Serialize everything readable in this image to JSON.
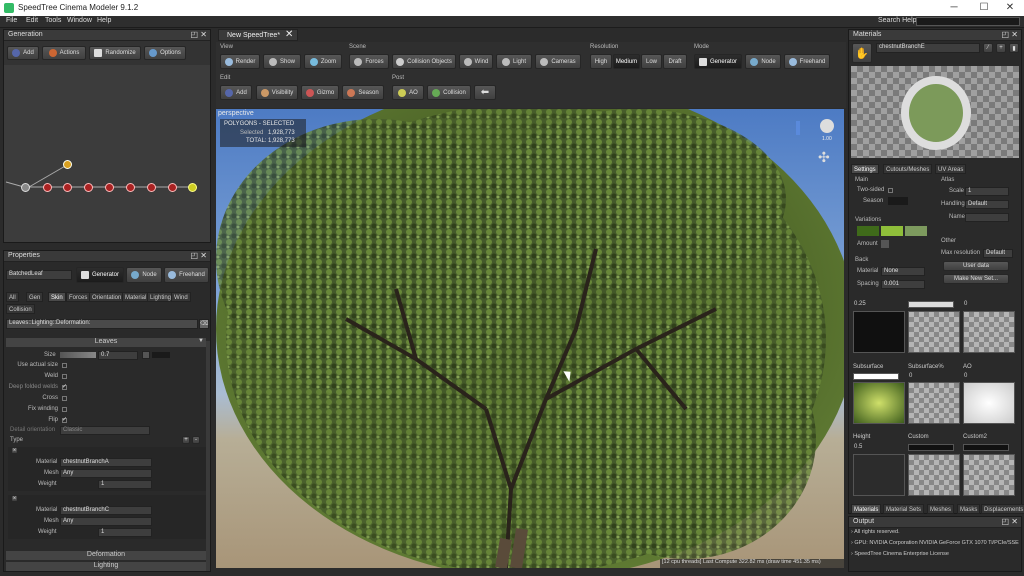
{
  "app": {
    "title": "SpeedTree Cinema Modeler 9.1.2"
  },
  "menu": [
    "File",
    "Edit",
    "Tools",
    "Window",
    "Help"
  ],
  "search_help": "Search Help:",
  "generation": {
    "title": "Generation",
    "buttons": [
      "Add",
      "Actions",
      "Randomize",
      "Options"
    ]
  },
  "properties": {
    "title": "Properties",
    "object_name": "BatchedLeaf",
    "mode_buttons": [
      "Generator",
      "Node",
      "Freehand"
    ],
    "tabs": [
      "All",
      "Gen",
      "Skin",
      "Forces",
      "Orientation",
      "Material",
      "Lighting",
      "Wind",
      "Collision"
    ],
    "filter": "Leaves::Lighting::Deformation:",
    "section_leaves": "Leaves",
    "size_label": "Size",
    "size_value": "0.7",
    "rows": [
      {
        "label": "Use actual size",
        "checked": false
      },
      {
        "label": "Weld",
        "checked": false
      },
      {
        "label": "Deep folded welds",
        "checked": true
      },
      {
        "label": "Cross",
        "checked": false
      },
      {
        "label": "Fix winding",
        "checked": false
      },
      {
        "label": "Flip",
        "checked": true
      }
    ],
    "detail_orientation": "Detail orientation",
    "detail_value": "Classic",
    "type_label": "Type",
    "group1": {
      "material_label": "Material",
      "material": "chestnutBranchA",
      "mesh_label": "Mesh",
      "mesh": "Any",
      "weight_label": "Weight",
      "weight": "1"
    },
    "group2": {
      "material_label": "Material",
      "material": "chestnutBranchC",
      "mesh_label": "Mesh",
      "mesh": "Any",
      "weight_label": "Weight",
      "weight": "1"
    },
    "section_deformation": "Deformation",
    "section_lighting": "Lighting"
  },
  "doc_tab": "New SpeedTree*",
  "toolbar": {
    "view_label": "View",
    "view": [
      "Render",
      "Show",
      "Zoom"
    ],
    "scene_label": "Scene",
    "scene": [
      "Forces",
      "Collision Objects",
      "Wind",
      "Light",
      "Cameras"
    ],
    "resolution_label": "Resolution",
    "resolution": [
      "High",
      "Medium",
      "Low",
      "Draft"
    ],
    "mode_label": "Mode",
    "mode": [
      "Generator",
      "Node",
      "Freehand"
    ],
    "edit_label": "Edit",
    "edit": [
      "Add",
      "Visibility",
      "Gizmo",
      "Season"
    ],
    "post_label": "Post",
    "post": [
      "AO",
      "Collision"
    ]
  },
  "viewport": {
    "label": "perspective",
    "polygons": "POLYGONS - SELECTED",
    "sel_label": "Selected",
    "selected": "1,928,773",
    "total_label": "TOTAL:",
    "total": "1,928,773",
    "status": "[12 cpu threads] Last Compute 322.82 ms (draw time 451.35 ms)",
    "light_value": "1.00"
  },
  "materials": {
    "title": "Materials",
    "name": "chestnutBranchE",
    "tabs": [
      "Settings",
      "Cutouts/Meshes",
      "UV Areas"
    ],
    "main_label": "Main",
    "two_sided": "Two-sided",
    "season": "Season",
    "atlas_label": "Atlas",
    "scale_label": "Scale",
    "scale": "1",
    "handling_label": "Handling",
    "handling": "Default",
    "name_label": "Name",
    "variations_label": "Variations",
    "amount_label": "Amount",
    "back_label": "Back",
    "material_label": "Material",
    "back_material": "None",
    "spacing_label": "Spacing",
    "spacing": "0.001",
    "other_label": "Other",
    "max_res_label": "Max resolution",
    "max_res": "Default",
    "user_data": "User data",
    "make_new_set": "Make New Set...",
    "variation_colors": [
      "#3f6a1a",
      "#8fbe3a",
      "#7d9a5e"
    ],
    "slots": [
      {
        "name": "",
        "value": "0.25"
      },
      {
        "name": "",
        "value": ""
      },
      {
        "name": "",
        "value": "0"
      },
      {
        "name": "Subsurface",
        "value": ""
      },
      {
        "name": "Subsurface%",
        "value": "0"
      },
      {
        "name": "AO",
        "value": "0"
      },
      {
        "name": "Height",
        "value": "0.5"
      },
      {
        "name": "Custom",
        "value": ""
      },
      {
        "name": "Custom2",
        "value": ""
      }
    ],
    "bottom_tabs": [
      "Materials",
      "Material Sets",
      "Meshes",
      "Masks",
      "Displacements"
    ]
  },
  "output": {
    "title": "Output",
    "lines": [
      "All rights reserved.",
      "GPU: NVIDIA Corporation NVIDIA GeForce GTX 1070 Ti/PCIe/SSE",
      "SpeedTree Cinema Enterprise License"
    ]
  }
}
